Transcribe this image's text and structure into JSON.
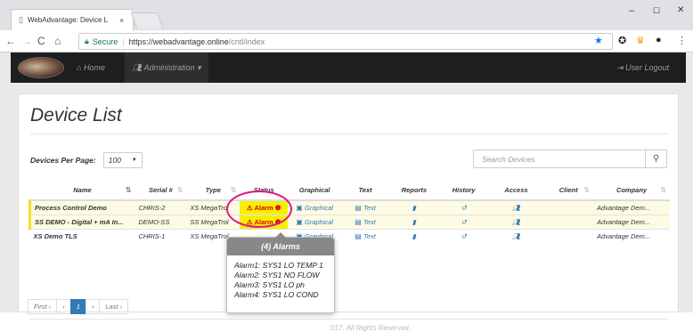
{
  "browser": {
    "tab_title": "WebAdvantage: Device L",
    "tab_close": "×",
    "minimize": "–",
    "maximize": "☐",
    "close": "✕",
    "secure_label": "Secure",
    "url_host": "https://webadvantage.online",
    "url_path": "/cntl/index"
  },
  "appnav": {
    "home": "Home",
    "administration": "Administration ▾",
    "logout": "User Logout"
  },
  "page": {
    "title": "Device List",
    "devices_per_page_label": "Devices Per Page:",
    "devices_per_page_value": "100",
    "search_placeholder": "Search Devices"
  },
  "table": {
    "headers": [
      "Name",
      "Serial #",
      "Type",
      "Status",
      "Graphical",
      "Text",
      "Reports",
      "History",
      "Access",
      "Client",
      "Company"
    ],
    "rows": [
      {
        "name": "Process Control Demo",
        "serial": "CHRIS-2",
        "type": "XS MegaTrol",
        "status": "Alarm",
        "graphical": "Graphical",
        "text": "Text",
        "company": "Advantage Dem..."
      },
      {
        "name": "SS DEMO - Digital + mA In...",
        "serial": "DEMO-SS",
        "type": "SS MegaTrol",
        "status": "Alarm",
        "graphical": "Graphical",
        "text": "Text",
        "company": "Advantage Dem..."
      },
      {
        "name": "XS Demo TLS",
        "serial": "CHRIS-1",
        "type": "XS MegaTrol",
        "status": "",
        "graphical": "Graphical",
        "text": "Text",
        "company": "Advantage Dem..."
      }
    ]
  },
  "pager": {
    "first": "First",
    "current": "1",
    "last": "Last"
  },
  "footer": "017. All Rights Reserved.",
  "popover": {
    "title": "(4) Alarms",
    "items": [
      "Alarm1: SYS1 LO TEMP 1",
      "Alarm2: SYS1 NO FLOW",
      "Alarm3: SYS1 LO ph",
      "Alarm4: SYS1 LO COND"
    ]
  },
  "colors": {
    "alarm_bg": "#f7ef00",
    "alarm_text": "#d9001b",
    "highlight_ring": "#e0148c",
    "link": "#337ab7"
  }
}
